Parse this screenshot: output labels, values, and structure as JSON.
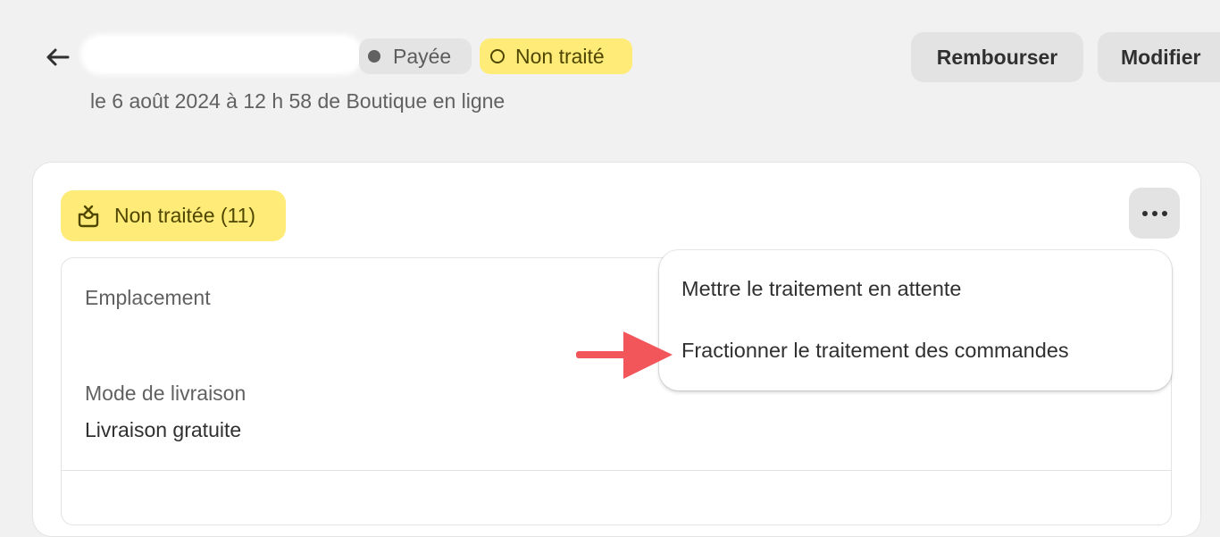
{
  "header": {
    "badges": {
      "payment": "Payée",
      "fulfillment": "Non traité"
    },
    "subtitle": "le 6 août 2024 à 12 h 58 de Boutique en ligne",
    "actions": {
      "refund": "Rembourser",
      "edit": "Modifier"
    }
  },
  "fulfillment_card": {
    "status_label": "Non traitée (11)",
    "location_label": "Emplacement",
    "shipping_label": "Mode de livraison",
    "shipping_value": "Livraison gratuite"
  },
  "menu": {
    "items": [
      "Mettre le traitement en attente",
      "Fractionner le traitement des commandes"
    ]
  },
  "colors": {
    "background": "#f1f1f1",
    "warning_yellow": "#ffeb78",
    "annotation_arrow": "#f2555a"
  },
  "icons": [
    "back-arrow-icon",
    "dot-icon",
    "circle-icon",
    "unfulfilled-box-icon",
    "more-horizontal-icon",
    "red-pointer-arrow"
  ]
}
